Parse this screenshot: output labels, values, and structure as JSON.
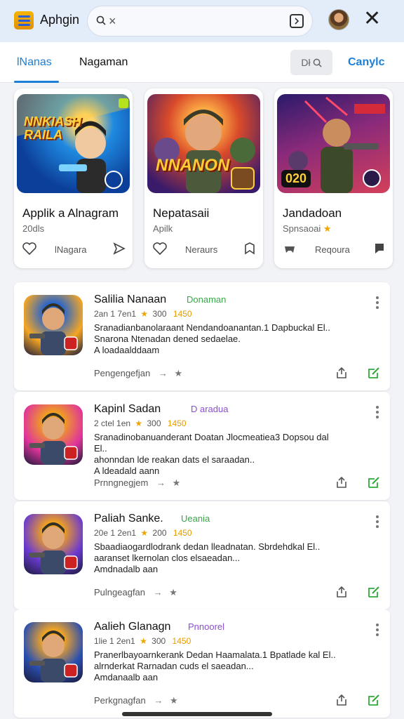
{
  "header": {
    "app_title": "Aphgin",
    "search": {
      "value": "",
      "placeholder": ""
    },
    "icons": {
      "logo": "hamburger-logo-icon",
      "search": "search-icon",
      "clear": "close-icon",
      "voice": "voice-square-icon",
      "avatar": "user-avatar",
      "close": "close-icon"
    }
  },
  "tabs": {
    "items": [
      {
        "label": "lNanas",
        "active": true
      },
      {
        "label": "Nagaman",
        "active": false
      }
    ],
    "filter_label": "Dł",
    "cancel_label": "Canylc"
  },
  "featured": [
    {
      "title": "Applik a Alnagram",
      "subtitle": "20dls",
      "action_label": "lNagara",
      "thumb_caption": "NNKIASH RAILA",
      "badge": ""
    },
    {
      "title": "Nepatasaii",
      "subtitle": "Apilk",
      "action_label": "Neraurs",
      "thumb_caption": "NNANON",
      "badge": ""
    },
    {
      "title": "Jandadoan",
      "subtitle": "Spnsaoai",
      "action_label": "Reqoura",
      "thumb_caption": "",
      "badge": "020"
    }
  ],
  "list": [
    {
      "name": "Salilia Nanaan",
      "tag": "Donaman",
      "tag_color": "#3aa64a",
      "meta_left": "2an 1 7en1",
      "rating": "300",
      "price": "1450",
      "desc_lines": [
        "Sranadianbanolaraant Nendandoanantan.1 Dapbuckal El..",
        "Snarona Ntenadan dened sedaelae.",
        "A loadaalddaam"
      ],
      "footer": "Pengengefjan",
      "thumb_colors": [
        "#f5a623",
        "#2b66c9"
      ]
    },
    {
      "name": "Kapinl Sadan",
      "tag": "D aradua",
      "tag_color": "#8a4fd1",
      "meta_left": "2 ctel 1en",
      "rating": "300",
      "price": "1450",
      "desc_lines": [
        "Sranadinobanuanderant Doatan Jlocmeatiea3 Dopsou dal El..",
        "ahonndan lde reakan dats el saraadan..",
        "A ldeadald aann"
      ],
      "footer": "Prnngnegjem",
      "thumb_colors": [
        "#e0349b",
        "#f0a020"
      ]
    },
    {
      "name": "Paliah Sanke.",
      "tag": "Ueania",
      "tag_color": "#3aa64a",
      "meta_left": "20e 1 2en1",
      "rating": "200",
      "price": "1450",
      "desc_lines": [
        "Sbaadiaogardlodrank dedan lleadnatan. Sbrdehdkal El..",
        "aaranset lkernolan clos elsaeadan...",
        "Amdnadalb aan"
      ],
      "footer": "Pulngeagfan",
      "thumb_colors": [
        "#6a3ad0",
        "#f0a020"
      ]
    },
    {
      "name": "Aalieh Glanagn",
      "tag": "Pnnoorel",
      "tag_color": "#8a4fd1",
      "meta_left": "1lie 1 2en1",
      "rating": "300",
      "price": "1450",
      "desc_lines": [
        "Pranerlbayoarnkerank Dedan Haamalata.1 Bpatlade kal El..",
        "alrnderkat Rarnadan cuds el saeadan...",
        "Amdanaalb aan"
      ],
      "footer": "Perkgnagfan",
      "thumb_colors": [
        "#2a4fb0",
        "#f5a623"
      ]
    }
  ]
}
